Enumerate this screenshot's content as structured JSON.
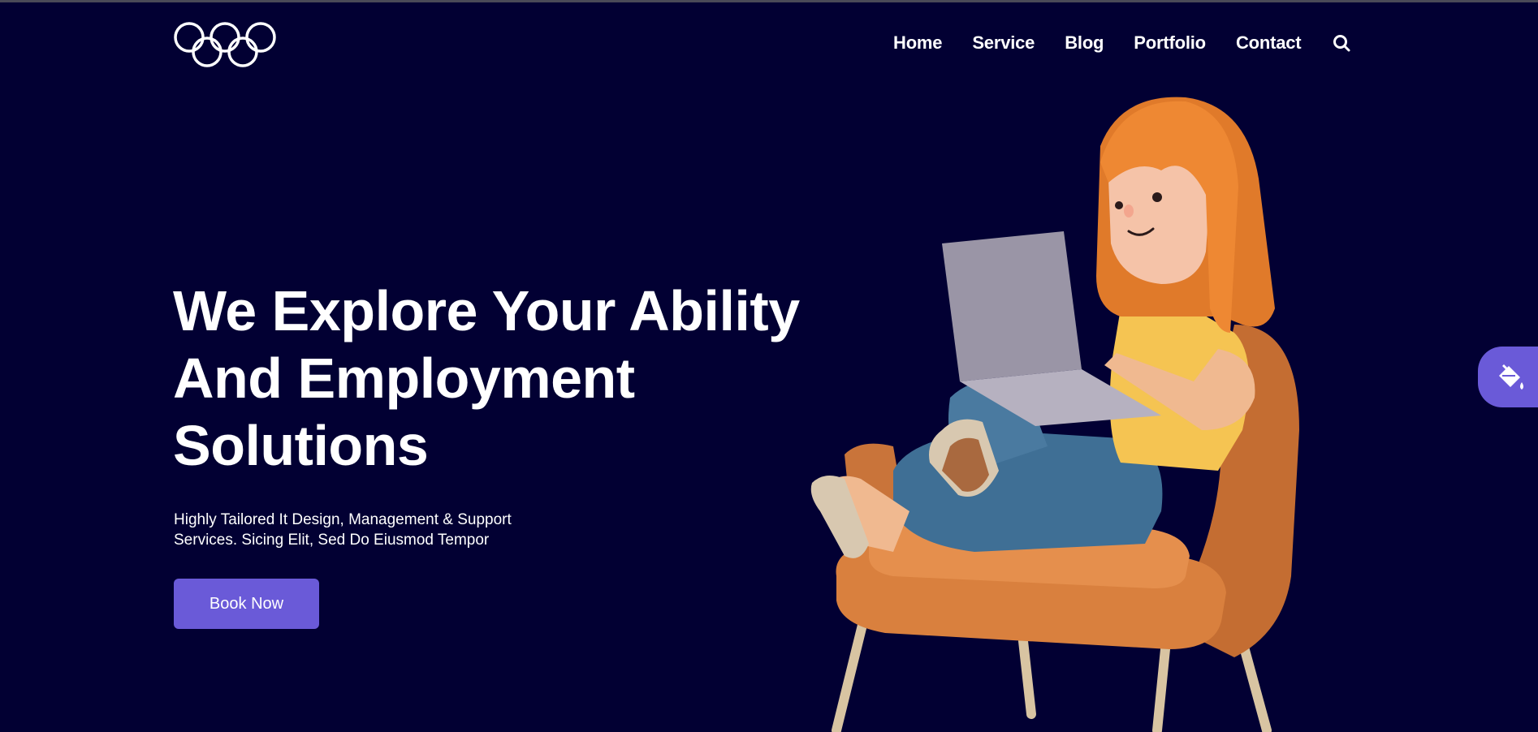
{
  "header": {
    "logo_name": "rings-logo",
    "nav": [
      {
        "label": "Home"
      },
      {
        "label": "Service"
      },
      {
        "label": "Blog"
      },
      {
        "label": "Portfolio"
      },
      {
        "label": "Contact"
      }
    ],
    "search_icon": "search-icon"
  },
  "hero": {
    "title_lines": [
      "We Explore Your Ability",
      "And Employment",
      "Solutions"
    ],
    "subtitle_lines": [
      "Highly Tailored It Design, Management & Support",
      "Services. Sicing Elit, Sed Do Eiusmod Tempor"
    ],
    "button_label": "Book Now"
  },
  "floating": {
    "icon": "paint-bucket-icon"
  },
  "colors": {
    "background": "#020033",
    "accent": "#6a5ad8",
    "text": "#ffffff"
  }
}
